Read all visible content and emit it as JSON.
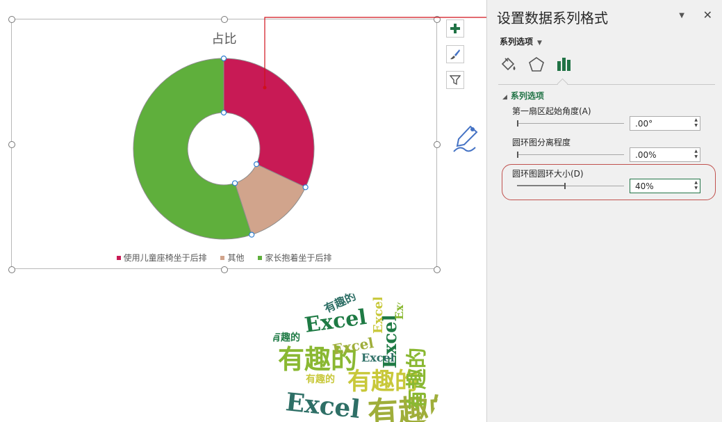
{
  "chart": {
    "title": "占比",
    "legend": [
      {
        "label": "使用儿童座椅坐于后排",
        "color": "#c81a55"
      },
      {
        "label": "其他",
        "color": "#d1a48c"
      },
      {
        "label": "家长抱着坐于后排",
        "color": "#5faf3c"
      }
    ]
  },
  "chart_data": {
    "type": "pie",
    "title": "占比",
    "categories": [
      "使用儿童座椅坐于后排",
      "其他",
      "家长抱着坐于后排"
    ],
    "values": [
      0.32,
      0.13,
      0.55
    ],
    "colors": [
      "#c81a55",
      "#d1a48c",
      "#5faf3c"
    ],
    "hole_size": 0.4,
    "legend_position": "bottom"
  },
  "side_buttons": {
    "add": "plus-icon",
    "style": "brush-icon",
    "filter": "filter-icon"
  },
  "pane": {
    "title": "设置数据系列格式",
    "menu_label": "系列选项",
    "section_label": "系列选项",
    "options": [
      {
        "label": "第一扇区起始角度(A)",
        "value": ".00°",
        "level": 0.0
      },
      {
        "label": "圆环图分离程度",
        "value": ".00%",
        "level": 0.0
      },
      {
        "label": "圆环图圆环大小(D)",
        "value": "40%",
        "level": 0.4
      }
    ]
  },
  "wordcloud": {
    "words": [
      "Excel",
      "有趣的",
      "有趣的",
      "Excel",
      "有趣的",
      "Excel",
      "有趣的",
      "Excel",
      "有趣的",
      "Excel",
      "有趣的",
      "Excel",
      "有趣的",
      "Excel"
    ],
    "colors": [
      "#1e7a44",
      "#8ab832",
      "#c8c83a",
      "#2e6f66",
      "#9fae3a"
    ]
  }
}
